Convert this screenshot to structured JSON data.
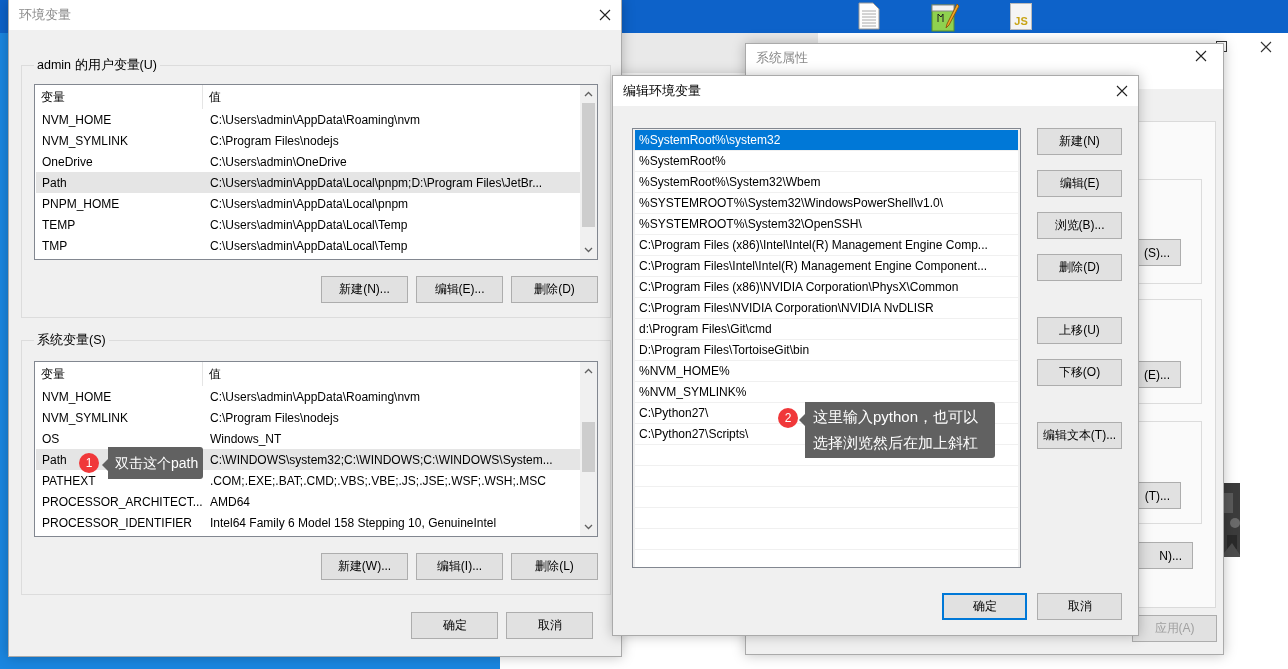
{
  "desktop": {
    "icons": [
      {
        "kind": "document"
      },
      {
        "kind": "notepad"
      },
      {
        "kind": "script",
        "label": "JS"
      }
    ]
  },
  "system_properties": {
    "title": "系统属性",
    "active": false,
    "buttons": [
      {
        "label": "(S)..."
      },
      {
        "label": "(E)..."
      },
      {
        "label": "(T)..."
      },
      {
        "label": "N)..."
      }
    ],
    "apply_button": {
      "label": "应用(A)",
      "disabled": true
    }
  },
  "env_dialog": {
    "title": "环境变量",
    "active": false,
    "groups": [
      {
        "label": "admin 的用户变量(U)",
        "columns": [
          "变量",
          "值"
        ],
        "rows": [
          {
            "name": "NVM_HOME",
            "value": "C:\\Users\\admin\\AppData\\Roaming\\nvm",
            "selected": false
          },
          {
            "name": "NVM_SYMLINK",
            "value": "C:\\Program Files\\nodejs",
            "selected": false
          },
          {
            "name": "OneDrive",
            "value": "C:\\Users\\admin\\OneDrive",
            "selected": false
          },
          {
            "name": "Path",
            "value": "C:\\Users\\admin\\AppData\\Local\\pnpm;D:\\Program Files\\JetBr...",
            "selected": true
          },
          {
            "name": "PNPM_HOME",
            "value": "C:\\Users\\admin\\AppData\\Local\\pnpm",
            "selected": false
          },
          {
            "name": "TEMP",
            "value": "C:\\Users\\admin\\AppData\\Local\\Temp",
            "selected": false
          },
          {
            "name": "TMP",
            "value": "C:\\Users\\admin\\AppData\\Local\\Temp",
            "selected": false
          }
        ],
        "buttons": [
          "新建(N)...",
          "编辑(E)...",
          "删除(D)"
        ]
      },
      {
        "label": "系统变量(S)",
        "columns": [
          "变量",
          "值"
        ],
        "rows": [
          {
            "name": "NVM_HOME",
            "value": "C:\\Users\\admin\\AppData\\Roaming\\nvm",
            "selected": false
          },
          {
            "name": "NVM_SYMLINK",
            "value": "C:\\Program Files\\nodejs",
            "selected": false
          },
          {
            "name": "OS",
            "value": "Windows_NT",
            "selected": false
          },
          {
            "name": "Path",
            "value": "C:\\WINDOWS\\system32;C:\\WINDOWS;C:\\WINDOWS\\System...",
            "selected": true
          },
          {
            "name": "PATHEXT",
            "value": ".COM;.EXE;.BAT;.CMD;.VBS;.VBE;.JS;.JSE;.WSF;.WSH;.MSC",
            "selected": false
          },
          {
            "name": "PROCESSOR_ARCHITECT...",
            "value": "AMD64",
            "selected": false
          },
          {
            "name": "PROCESSOR_IDENTIFIER",
            "value": "Intel64 Family 6 Model 158 Stepping 10, GenuineIntel",
            "selected": false
          }
        ],
        "buttons": [
          "新建(W)...",
          "编辑(I)...",
          "删除(L)"
        ]
      }
    ],
    "buttons": [
      "确定",
      "取消"
    ]
  },
  "edit_dialog": {
    "title": "编辑环境变量",
    "active": true,
    "entries": [
      {
        "text": "%SystemRoot%\\system32",
        "selected": true
      },
      {
        "text": "%SystemRoot%",
        "selected": false
      },
      {
        "text": "%SystemRoot%\\System32\\Wbem",
        "selected": false
      },
      {
        "text": "%SYSTEMROOT%\\System32\\WindowsPowerShell\\v1.0\\",
        "selected": false
      },
      {
        "text": "%SYSTEMROOT%\\System32\\OpenSSH\\",
        "selected": false
      },
      {
        "text": "C:\\Program Files (x86)\\Intel\\Intel(R) Management Engine Comp...",
        "selected": false
      },
      {
        "text": "C:\\Program Files\\Intel\\Intel(R) Management Engine Component...",
        "selected": false
      },
      {
        "text": "C:\\Program Files (x86)\\NVIDIA Corporation\\PhysX\\Common",
        "selected": false
      },
      {
        "text": "C:\\Program Files\\NVIDIA Corporation\\NVIDIA NvDLISR",
        "selected": false
      },
      {
        "text": "d:\\Program Files\\Git\\cmd",
        "selected": false
      },
      {
        "text": "D:\\Program Files\\TortoiseGit\\bin",
        "selected": false
      },
      {
        "text": "%NVM_HOME%",
        "selected": false
      },
      {
        "text": "%NVM_SYMLINK%",
        "selected": false
      },
      {
        "text": "C:\\Python27\\",
        "selected": false
      },
      {
        "text": "C:\\Python27\\Scripts\\",
        "selected": false
      }
    ],
    "side_buttons": [
      [
        "新建(N)",
        "编辑(E)",
        "浏览(B)...",
        "删除(D)"
      ],
      [
        "上移(U)",
        "下移(O)"
      ],
      [
        "编辑文本(T)..."
      ]
    ],
    "buttons": [
      {
        "label": "确定",
        "default": true
      },
      {
        "label": "取消",
        "default": false
      }
    ]
  },
  "callouts": [
    {
      "number": "1",
      "text": "双击这个path"
    },
    {
      "number": "2",
      "text": "这里输入python，也可以选择浏览然后在加上斜杠"
    }
  ]
}
